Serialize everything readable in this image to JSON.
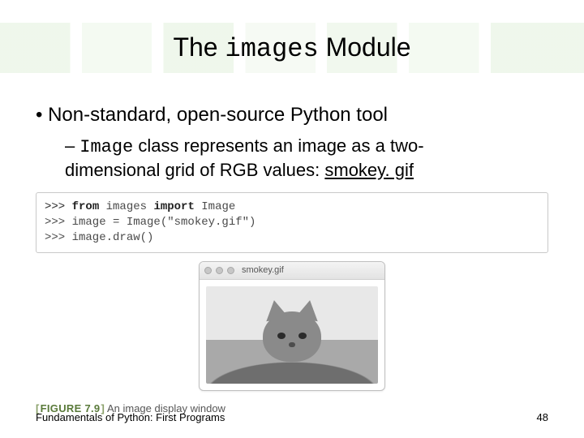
{
  "title": {
    "pre": "The ",
    "code": "images",
    "post": " Module"
  },
  "bullets": {
    "b1": "Non-standard, open-source Python tool",
    "b2": {
      "dash": "–",
      "code": "Image",
      "rest_line1": " class represents an image as a two-",
      "rest_line2": "dimensional grid of RGB values: ",
      "link": "smokey. gif"
    }
  },
  "code": {
    "l1_prompt": ">>> ",
    "l1_kw1": "from",
    "l1_mid": " images ",
    "l1_kw2": "import",
    "l1_end": " Image",
    "l2": ">>> image = Image(\"smokey.gif\")",
    "l3": ">>> image.draw()"
  },
  "window": {
    "filename": "smokey.gif"
  },
  "figure": {
    "label": "FIGURE 7.9",
    "caption": " An image display window"
  },
  "footer": {
    "left": "Fundamentals of Python: First Programs",
    "page": "48"
  }
}
